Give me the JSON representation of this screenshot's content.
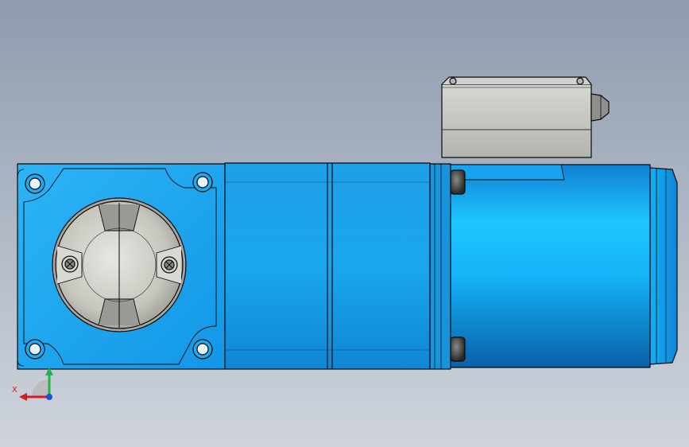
{
  "viewport": {
    "background_top": "#8f9cae",
    "background_bottom": "#cfd4dc"
  },
  "model": {
    "body_color": "#1aa8f0",
    "body_highlight": "#36c3ff",
    "body_shadow": "#0b78c4",
    "motor_color": "#12b6f7",
    "terminal_box_color": "#c5c6c3",
    "metal_color": "#c9c9c3",
    "edge_color": "#0a0a0a"
  },
  "triad": {
    "x_label": "X",
    "x_color": "#d71920",
    "y_color": "#22b24c",
    "z_color": "#1f4fd6"
  }
}
